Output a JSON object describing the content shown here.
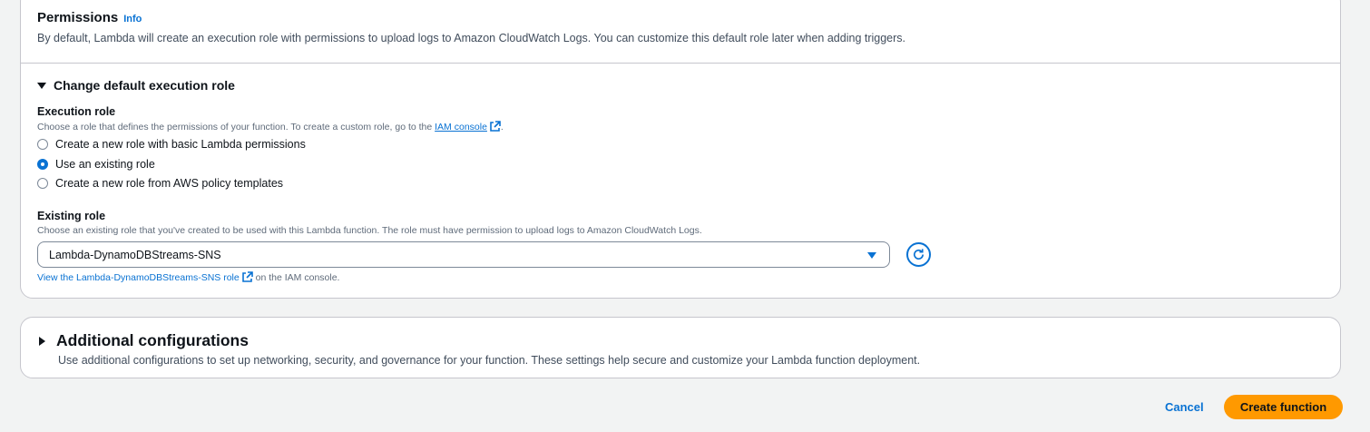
{
  "permissions": {
    "title": "Permissions",
    "info_label": "Info",
    "description": "By default, Lambda will create an execution role with permissions to upload logs to Amazon CloudWatch Logs. You can customize this default role later when adding triggers."
  },
  "execution_role_section": {
    "expander_label": "Change default execution role",
    "expanded": true,
    "label": "Execution role",
    "description_prefix": "Choose a role that defines the permissions of your function. To create a custom role, go to the",
    "iam_console_link": "IAM console",
    "description_suffix": ".",
    "options": [
      {
        "label": "Create a new role with basic Lambda permissions",
        "selected": false
      },
      {
        "label": "Use an existing role",
        "selected": true
      },
      {
        "label": "Create a new role from AWS policy templates",
        "selected": false
      }
    ]
  },
  "existing_role": {
    "label": "Existing role",
    "description": "Choose an existing role that you've created to be used with this Lambda function. The role must have permission to upload logs to Amazon CloudWatch Logs.",
    "selected_value": "Lambda-DynamoDBStreams-SNS",
    "view_link": "View the Lambda-DynamoDBStreams-SNS role",
    "view_link_suffix": "on the IAM console."
  },
  "additional_configurations": {
    "title": "Additional configurations",
    "expanded": false,
    "description": "Use additional configurations to set up networking, security, and governance for your function. These settings help secure and customize your Lambda function deployment."
  },
  "footer": {
    "cancel_label": "Cancel",
    "create_label": "Create function"
  },
  "colors": {
    "link": "#0972d3",
    "primary_button": "#ff9900",
    "background": "#f2f3f3"
  }
}
